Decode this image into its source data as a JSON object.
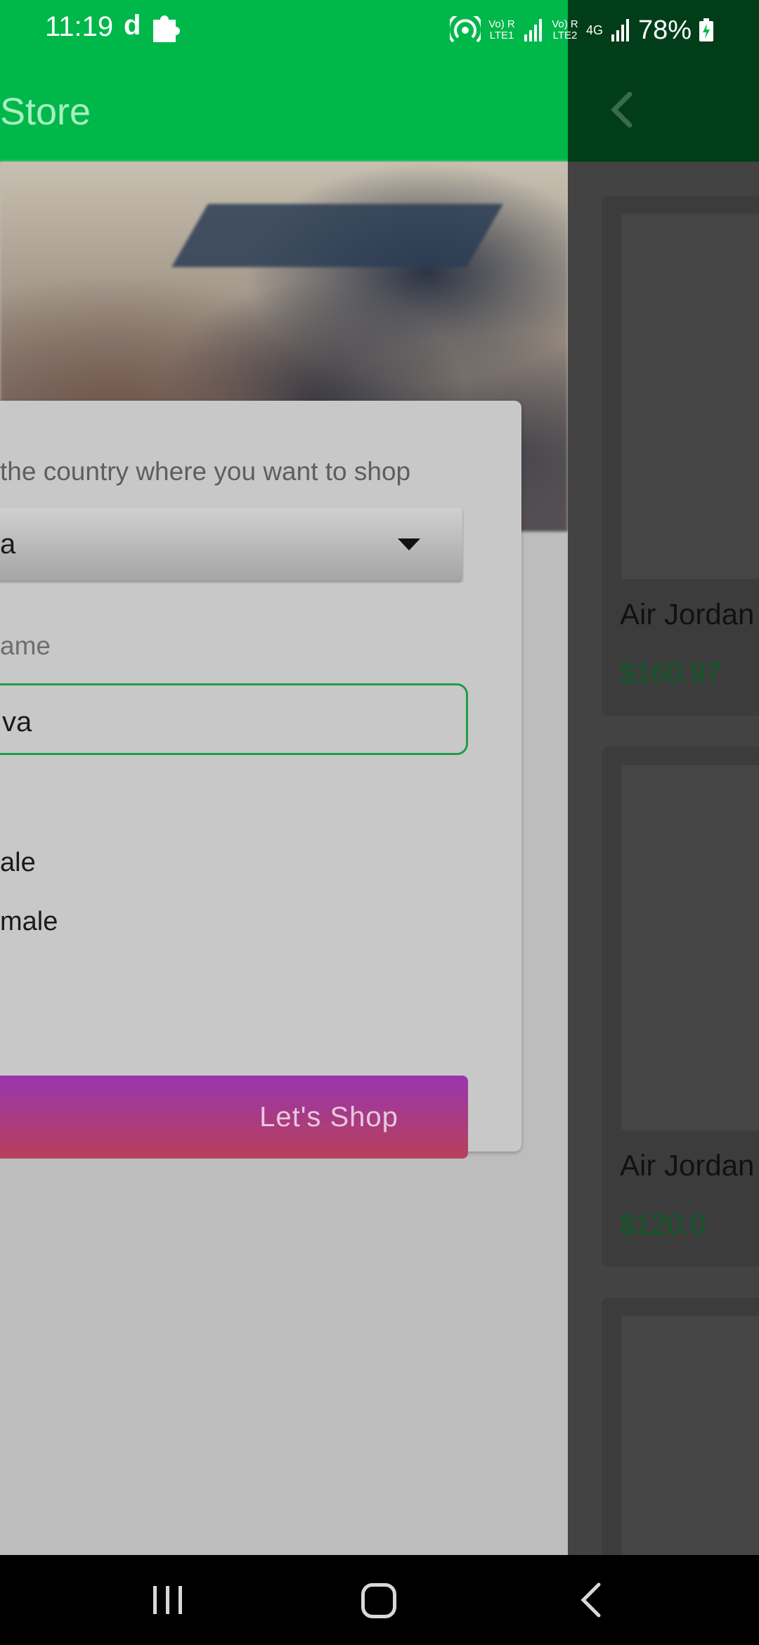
{
  "status_bar": {
    "time": "11:19",
    "left_icons": [
      "d",
      "puzzle-icon"
    ],
    "sim1_label": "Vo) R LTE1",
    "sim2_label": "Vo) R LTE2",
    "network": "4G",
    "battery": "78%"
  },
  "drawer": {
    "toolbar_title": "Store",
    "form": {
      "country_label": "the country where you want to shop",
      "country_value": "a",
      "name_label": "ame",
      "name_value": "va",
      "gender_options": [
        "ale",
        "male"
      ],
      "submit_label": "Let's Shop"
    }
  },
  "products": [
    {
      "name": "Air Jordan",
      "price": "$160.97"
    },
    {
      "name": "Air Jordan",
      "price": "$120.0"
    }
  ],
  "colors": {
    "brand_green": "#00b74a",
    "accent_green": "#1f9d48",
    "button_gradient_top": "#9a35b0",
    "button_gradient_bottom": "#b7405a"
  }
}
